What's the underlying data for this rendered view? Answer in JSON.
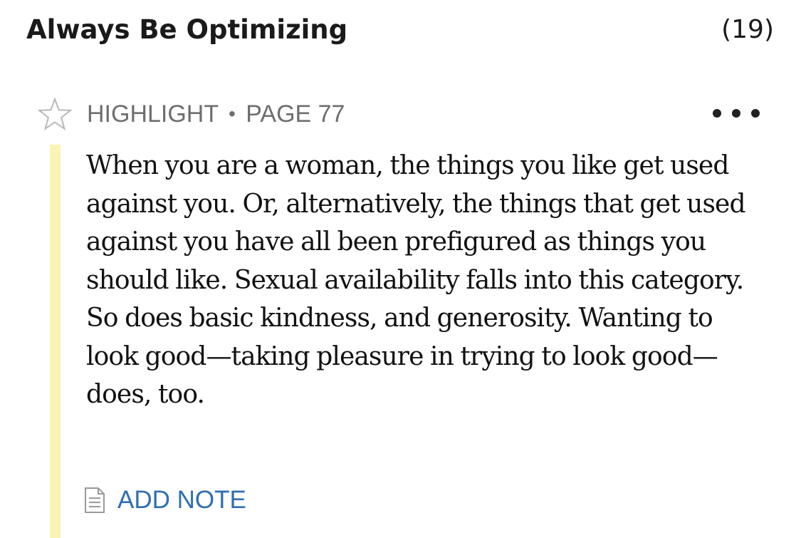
{
  "header": {
    "title": "Always Be Optimizing",
    "count": "(19)"
  },
  "highlight": {
    "star_icon": "star-outline-icon",
    "type_label": "HIGHLIGHT",
    "separator": "•",
    "page_label": "PAGE 77",
    "more_icon": "more-horizontal-icon",
    "highlight_color": "#fbf3b4",
    "text": "When you are a woman, the things you like get used against you. Or, alternatively, the things that get used against you have all been prefigured as things you should like. Sexual availability falls into this category. So does basic kindness, and generosity. Wanting to look good—taking pleasure in trying to look good—does, too."
  },
  "note": {
    "icon": "note-document-icon",
    "label": "ADD NOTE",
    "color": "#2f6fb2"
  }
}
